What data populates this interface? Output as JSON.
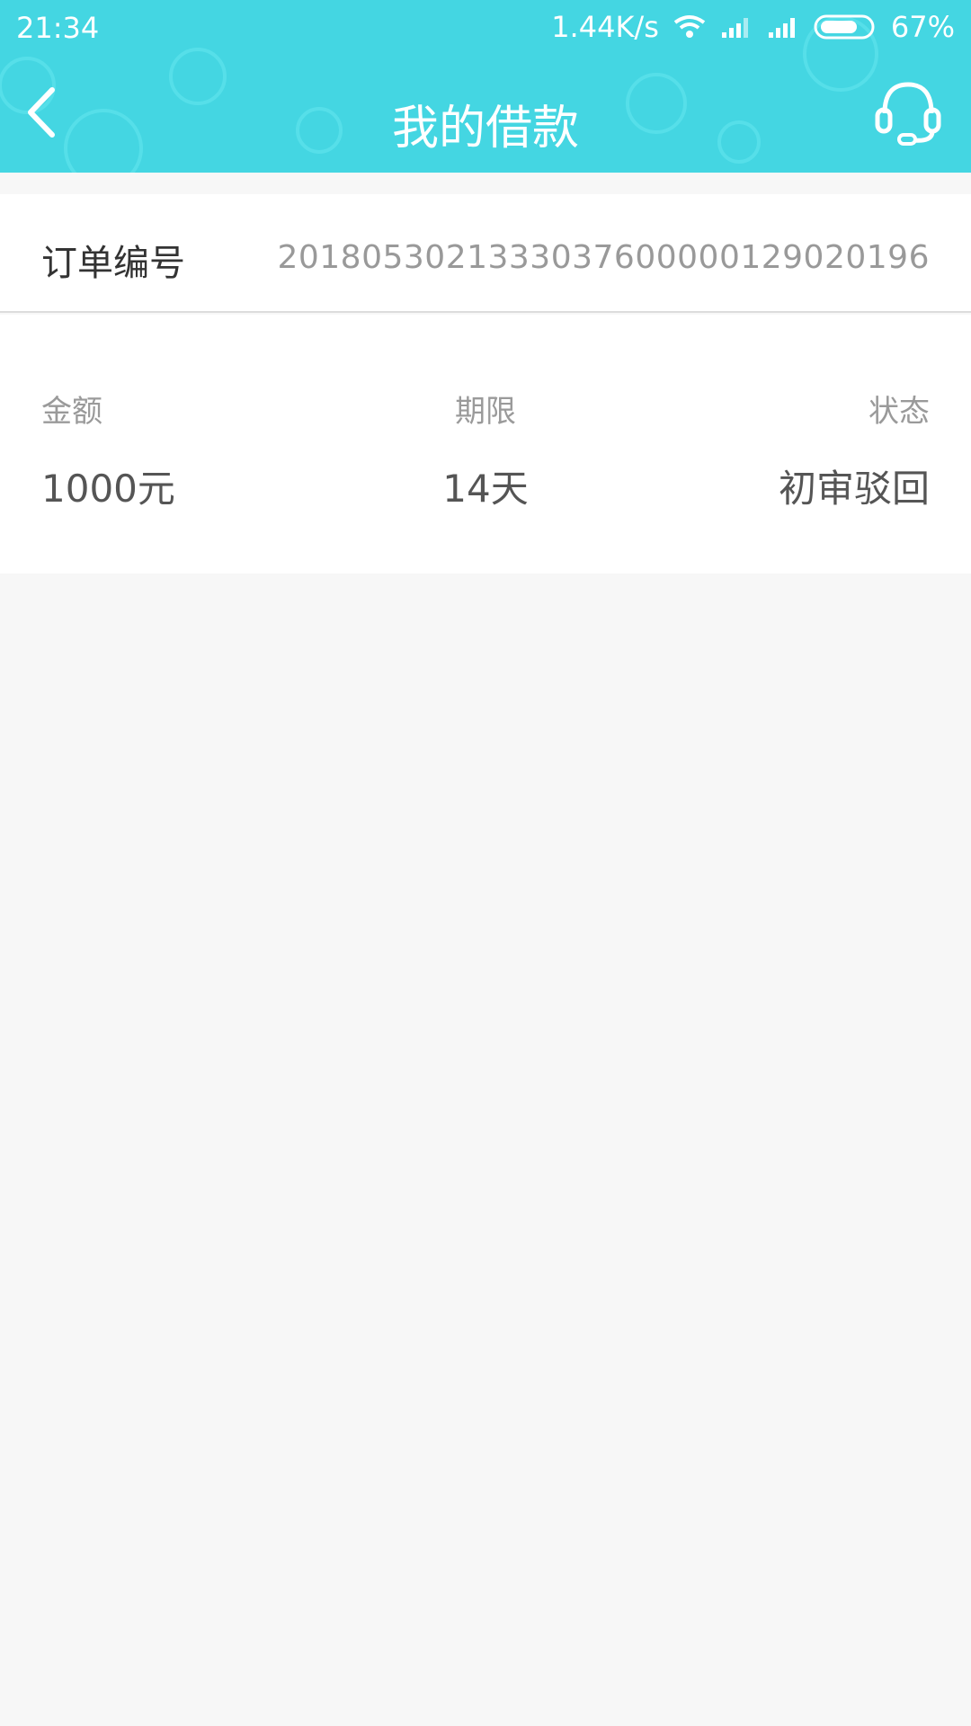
{
  "status_bar": {
    "time": "21:34",
    "network_speed": "1.44K/s",
    "battery": "67%",
    "icons": [
      "wifi-icon",
      "signal-icon",
      "signal-icon",
      "battery-icon"
    ]
  },
  "header": {
    "title": "我的借款",
    "back_icon": "back-arrow-icon",
    "service_icon": "headset-icon",
    "background_color": "#44d6e2"
  },
  "order": {
    "label": "订单编号",
    "value": "2018053021333037600000129020196"
  },
  "details": {
    "amount": {
      "label": "金额",
      "value": "1000元"
    },
    "term": {
      "label": "期限",
      "value": "14天"
    },
    "status": {
      "label": "状态",
      "value": "初审驳回"
    }
  }
}
